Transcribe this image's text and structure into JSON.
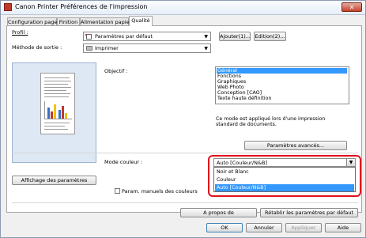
{
  "window": {
    "title": "Canon Printer Préférences de l'impression",
    "close_label": "✕"
  },
  "tabs": [
    {
      "label": "Configuration page"
    },
    {
      "label": "Finition"
    },
    {
      "label": "Alimentation papier"
    },
    {
      "label": "Qualité"
    }
  ],
  "profile": {
    "label": "Profil :",
    "value": "Paramètres par défaut",
    "add_button": "Ajouter(1)...",
    "edit_button": "Edition(2)..."
  },
  "output_method": {
    "label": "Méthode de sortie :",
    "value": "Imprimer"
  },
  "objective": {
    "label": "Objectif :",
    "items": [
      "Général",
      "Fonctions",
      "Graphiques",
      "Web Photo",
      "Conception [CAO]",
      "Texte haute définition"
    ],
    "selected_index": 0,
    "description": "Ce mode est appliqué lors d'une impression standard de documents.",
    "advanced_button": "Paramètres avancés..."
  },
  "color_mode": {
    "label": "Mode couleur :",
    "value": "Auto [Couleur/N&B]",
    "options": [
      "Noir et Blanc",
      "Couleur",
      "Auto [Couleur/N&B]"
    ],
    "selected_index": 2
  },
  "show_settings_button": "Affichage des paramètres",
  "manual_color": {
    "label": "Param. manuels des couleurs",
    "checked": false
  },
  "footer": {
    "about_button": "A propos de",
    "restore_button": "Rétablir les paramètres par défaut",
    "ok": "OK",
    "cancel": "Annuler",
    "apply": "Appliquer",
    "help": "Aide"
  },
  "colors": {
    "selection": "#3399ff",
    "highlight_frame": "#e0101a"
  }
}
